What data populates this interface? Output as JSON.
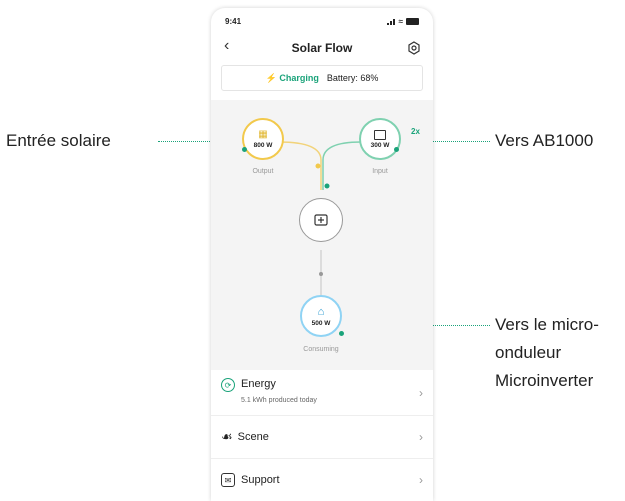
{
  "callouts": {
    "solar_input": "Entrée solaire",
    "to_ab": "Vers AB1000",
    "to_micro_line1": "Vers le micro-",
    "to_micro_line2": "onduleur",
    "to_micro_line3": "Microinverter"
  },
  "status_bar": {
    "time": "9:41"
  },
  "header": {
    "title": "Solar Flow",
    "back_icon": "chevron-left-icon",
    "settings_icon": "settings-hex-icon"
  },
  "charging": {
    "status": "Charging",
    "battery": "Battery: 68%"
  },
  "flow": {
    "output": {
      "value": "800 W",
      "label": "Output",
      "color": "#f2c94c"
    },
    "input": {
      "value": "300 W",
      "label": "Input",
      "badge": "2x",
      "color": "#1aa37a"
    },
    "consuming": {
      "value": "500 W",
      "label": "Consuming",
      "color": "#8fd3f4"
    }
  },
  "menu": {
    "energy": {
      "label": "Energy",
      "sub": "5.1 kWh produced today"
    },
    "scene": {
      "label": "Scene"
    },
    "support": {
      "label": "Support"
    }
  },
  "colors": {
    "accent": "#1aa37a",
    "solar": "#f2c94c",
    "consume": "#8fd3f4"
  }
}
